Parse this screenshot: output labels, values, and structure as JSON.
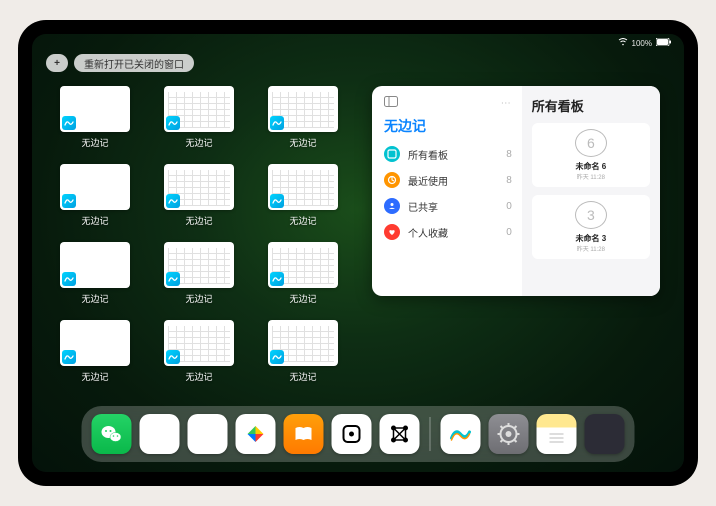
{
  "status": {
    "time": "",
    "battery": "100%"
  },
  "topbar": {
    "plus": "+",
    "reopen_label": "重新打开已关闭的窗口"
  },
  "windows": [
    {
      "label": "无边记",
      "type": "blank"
    },
    {
      "label": "无边记",
      "type": "calendar"
    },
    {
      "label": "无边记",
      "type": "calendar"
    },
    {
      "label": "无边记",
      "type": "blank"
    },
    {
      "label": "无边记",
      "type": "calendar"
    },
    {
      "label": "无边记",
      "type": "calendar"
    },
    {
      "label": "无边记",
      "type": "blank"
    },
    {
      "label": "无边记",
      "type": "calendar"
    },
    {
      "label": "无边记",
      "type": "calendar"
    },
    {
      "label": "无边记",
      "type": "blank"
    },
    {
      "label": "无边记",
      "type": "calendar"
    },
    {
      "label": "无边记",
      "type": "calendar"
    }
  ],
  "panel": {
    "left_title": "无边记",
    "rows": [
      {
        "icon": "cyan",
        "label": "所有看板",
        "count": "8"
      },
      {
        "icon": "orange",
        "label": "最近使用",
        "count": "8"
      },
      {
        "icon": "blue",
        "label": "已共享",
        "count": "0"
      },
      {
        "icon": "red",
        "label": "个人收藏",
        "count": "0"
      }
    ],
    "right_title": "所有看板",
    "boards": [
      {
        "glyph": "6",
        "name": "未命名 6",
        "sub": "昨天 11:28"
      },
      {
        "glyph": "3",
        "name": "未命名 3",
        "sub": "昨天 11:28"
      }
    ]
  },
  "dock": {
    "apps": [
      {
        "name": "wechat",
        "class": "di-wechat"
      },
      {
        "name": "quark-hd",
        "class": "di-q1"
      },
      {
        "name": "quark",
        "class": "di-q2"
      },
      {
        "name": "play",
        "class": "di-play"
      },
      {
        "name": "books",
        "class": "di-books"
      },
      {
        "name": "dice",
        "class": "di-dice"
      },
      {
        "name": "graph",
        "class": "di-graph"
      }
    ],
    "recents": [
      {
        "name": "freeform",
        "class": "di-freeform"
      },
      {
        "name": "settings",
        "class": "di-settings"
      },
      {
        "name": "notes",
        "class": "di-notes"
      },
      {
        "name": "app-library",
        "class": "di-folder"
      }
    ]
  }
}
